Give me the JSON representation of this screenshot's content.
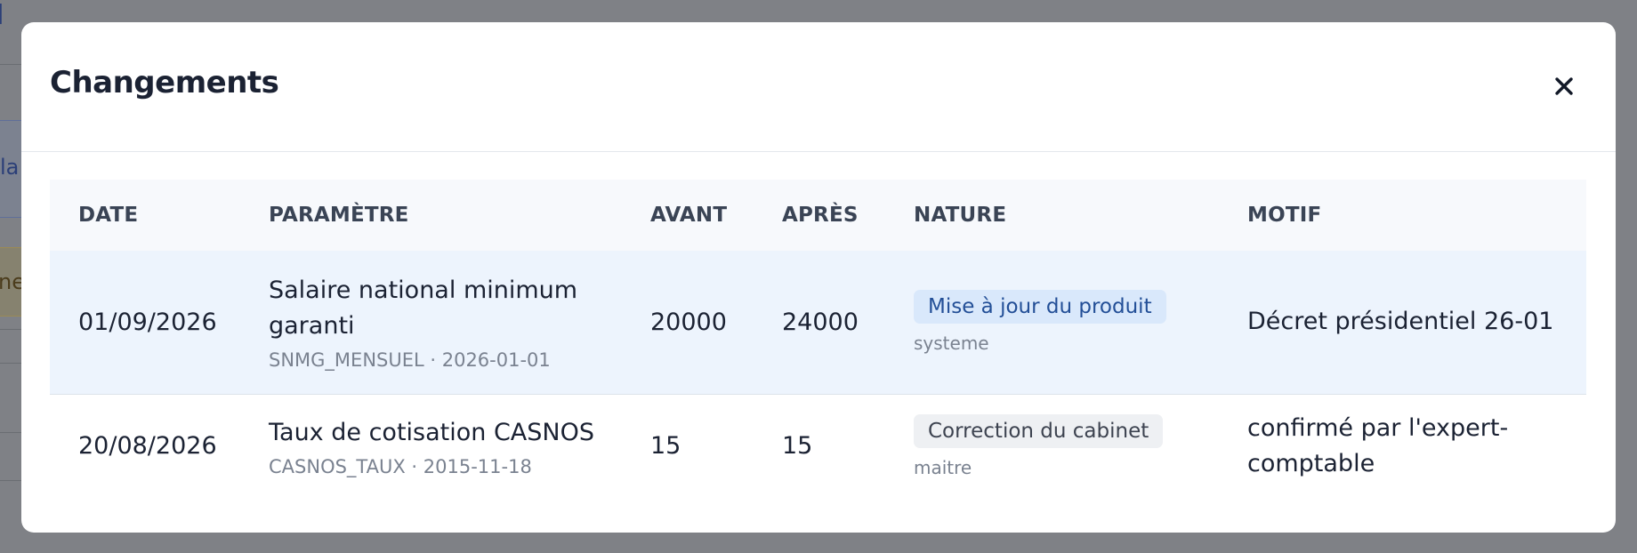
{
  "background": {
    "title_fragment": "l",
    "card_fragment": "la",
    "alert_fragment": "ne"
  },
  "modal": {
    "title": "Changements",
    "close_label": "×"
  },
  "table": {
    "headers": {
      "date": "DATE",
      "parametre": "PARAMÈTRE",
      "avant": "AVANT",
      "apres": "APRÈS",
      "nature": "NATURE",
      "motif": "MOTIF"
    },
    "rows": [
      {
        "date": "01/09/2026",
        "param_name": "Salaire national minimum garanti",
        "param_sub": "SNMG_MENSUEL · 2026-01-01",
        "avant": "20000",
        "apres": "24000",
        "nature_badge": "Mise à jour du produit",
        "nature_sub": "systeme",
        "motif": "Décret présidentiel 26-01"
      },
      {
        "date": "20/08/2026",
        "param_name": "Taux de cotisation CASNOS",
        "param_sub": "CASNOS_TAUX · 2015-11-18",
        "avant": "15",
        "apres": "15",
        "nature_badge": "Correction du cabinet",
        "nature_sub": "maitre",
        "motif": "confirmé par l'expert-comptable"
      }
    ]
  },
  "colors": {
    "overlay": "#808080",
    "modal_bg": "#ffffff",
    "highlight_row": "#edf4fd",
    "badge_blue_bg": "#d9e8fb",
    "badge_blue_text": "#234f97",
    "badge_gray_bg": "#eef0f3"
  },
  "icons": {
    "close": "close-icon"
  }
}
